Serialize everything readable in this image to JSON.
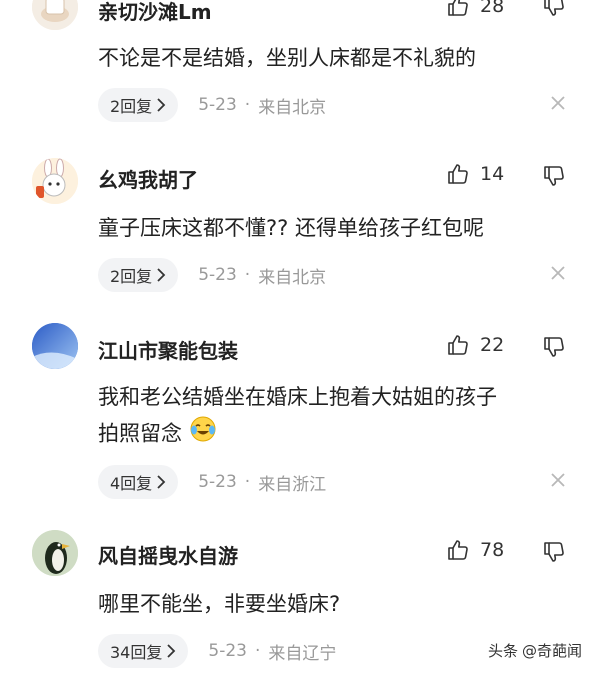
{
  "comments": [
    {
      "username": "亲切沙滩Lm",
      "like_count": "28",
      "lines": [
        "不论是不是结婚，坐别人床都是不礼貌的"
      ],
      "reply_label": "2回复",
      "date": "5-23",
      "location": "来自北京"
    },
    {
      "username": "幺鸡我胡了",
      "like_count": "14",
      "lines": [
        "童子压床这都不懂?? 还得单给孩子红包呢"
      ],
      "reply_label": "2回复",
      "date": "5-23",
      "location": "来自北京"
    },
    {
      "username": "江山市聚能包装",
      "like_count": "22",
      "lines": [
        "我和老公结婚坐在婚床上抱着大姑姐的孩子",
        "拍照留念"
      ],
      "reply_label": "4回复",
      "date": "5-23",
      "location": "来自浙江"
    },
    {
      "username": "风自摇曳水自游",
      "like_count": "78",
      "lines": [
        "哪里不能坐，非要坐婚床?"
      ],
      "reply_label": "34回复",
      "date": "5-23",
      "location": "来自辽宁"
    }
  ],
  "meta_separator": "·",
  "watermark": {
    "source": "头条",
    "account": "@奇葩闻"
  },
  "icons": {
    "like": "thumbs-up-icon",
    "dislike": "thumbs-down-icon",
    "close": "close-icon",
    "reply_chevron": "chevron-right-icon",
    "emoji": "crying-laughing-emoji-icon"
  }
}
